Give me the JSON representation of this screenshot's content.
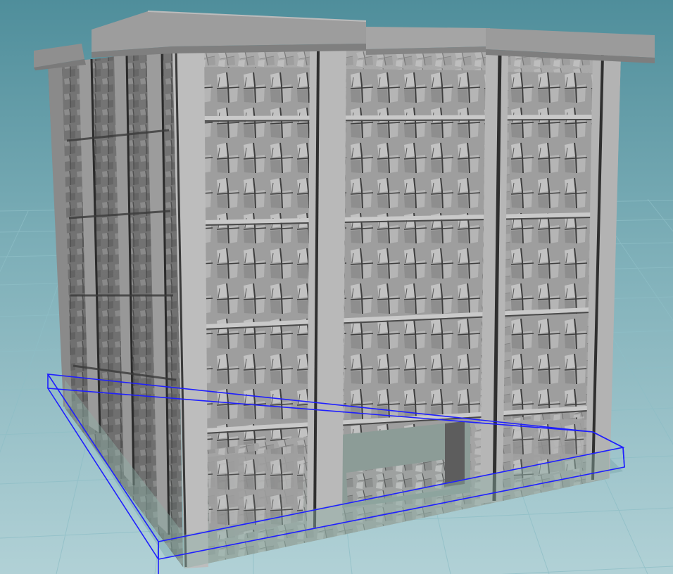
{
  "viewport": {
    "kind": "3d-viewport",
    "background": {
      "top": "#5f9aa6",
      "bottom": "#a7c9cf"
    },
    "grid_color": "#7fb3bc",
    "bounding_box_color": "#1f1fff"
  },
  "model": {
    "object": "building",
    "shading": "flat-grey",
    "base_color": "#a9a9a9",
    "light_color": "#c4c4c4",
    "dark_color": "#4c4c4c",
    "bottom_tint": "#8faaa4"
  }
}
